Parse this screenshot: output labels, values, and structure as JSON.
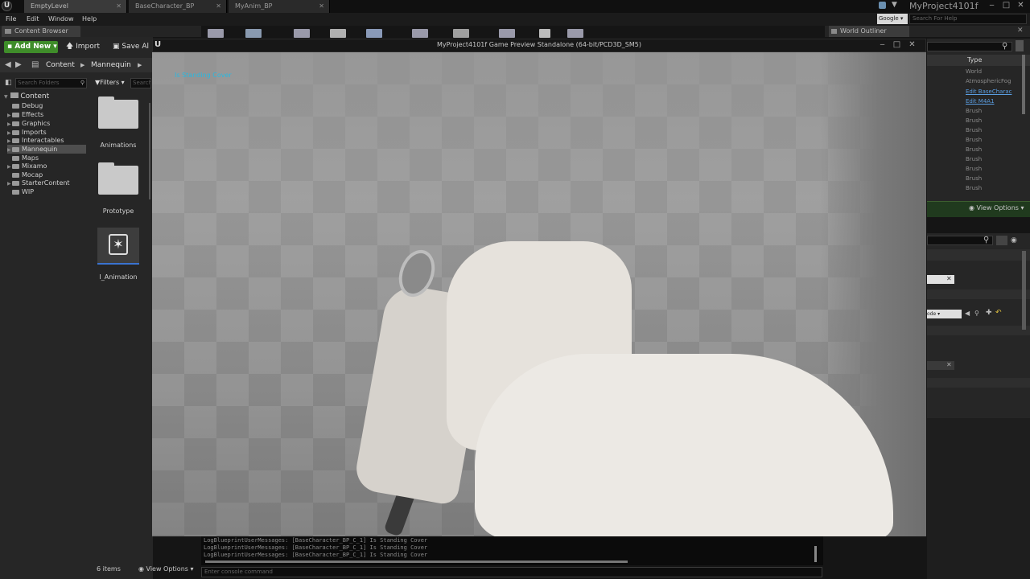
{
  "app": {
    "window_title": "MyProject4101f",
    "tabs": [
      {
        "label": "EmptyLevel",
        "active": true
      },
      {
        "label": "BaseCharacter_BP",
        "active": false
      },
      {
        "label": "MyAnim_BP",
        "active": false
      }
    ]
  },
  "menu": [
    "File",
    "Edit",
    "Window",
    "Help"
  ],
  "help_search": {
    "provider": "Google",
    "placeholder": "Search For Help"
  },
  "content_browser": {
    "tab_label": "Content Browser",
    "add_new": "Add New",
    "import": "Import",
    "save_all": "Save Al",
    "breadcrumb": [
      "Content",
      "Mannequin"
    ],
    "search_folders_placeholder": "Search Folders",
    "filters_label": "Filters",
    "search_assets_placeholder": "Search",
    "tree_root": "Content",
    "tree_items": [
      {
        "label": "Debug",
        "caret": false
      },
      {
        "label": "Effects",
        "caret": true
      },
      {
        "label": "Graphics",
        "caret": true
      },
      {
        "label": "Imports",
        "caret": true
      },
      {
        "label": "Interactables",
        "caret": true
      },
      {
        "label": "Mannequin",
        "caret": true,
        "selected": true
      },
      {
        "label": "Maps",
        "caret": false
      },
      {
        "label": "Mixamo",
        "caret": true
      },
      {
        "label": "Mocap",
        "caret": false
      },
      {
        "label": "StarterContent",
        "caret": true
      },
      {
        "label": "WIP",
        "caret": false
      }
    ],
    "assets": [
      {
        "label": "Animations",
        "kind": "folder"
      },
      {
        "label": "Prototype",
        "kind": "folder"
      },
      {
        "label": "I_Animation",
        "kind": "animation"
      }
    ],
    "item_count": "6 items",
    "view_options": "View Options"
  },
  "game_preview": {
    "title": "MyProject4101f Game Preview Standalone (64-bit/PCD3D_SM5)",
    "debug_message": "Is Standing Cover"
  },
  "world_outliner": {
    "tab_label": "World Outliner",
    "column_type": "Type",
    "rows": [
      {
        "label": "World",
        "link": false
      },
      {
        "label": "AtmosphericFog",
        "link": false
      },
      {
        "label": "Edit BaseCharac",
        "link": true
      },
      {
        "label": "Edit M4A1",
        "link": true
      },
      {
        "label": "Brush",
        "link": false
      },
      {
        "label": "Brush",
        "link": false
      },
      {
        "label": "Brush",
        "link": false
      },
      {
        "label": "Brush",
        "link": false
      },
      {
        "label": "Brush",
        "link": false
      },
      {
        "label": "Brush",
        "link": false
      },
      {
        "label": "Brush",
        "link": false
      },
      {
        "label": "Brush",
        "link": false
      },
      {
        "label": "Brush",
        "link": false
      }
    ],
    "view_options": "View Options"
  },
  "details": {
    "dropdown_value": "ode"
  },
  "output_log": {
    "lines": [
      "LogBlueprintUserMessages: [BaseCharacter_BP_C_1] Is Standing Cover",
      "LogBlueprintUserMessages: [BaseCharacter_BP_C_1] Is Standing Cover",
      "LogBlueprintUserMessages: [BaseCharacter_BP_C_1] Is Standing Cover"
    ],
    "console_placeholder": "Enter console command"
  },
  "colors": {
    "accent_green": "#3f8d2a",
    "debug_text": "#29b8e0",
    "link": "#5a9de0"
  }
}
